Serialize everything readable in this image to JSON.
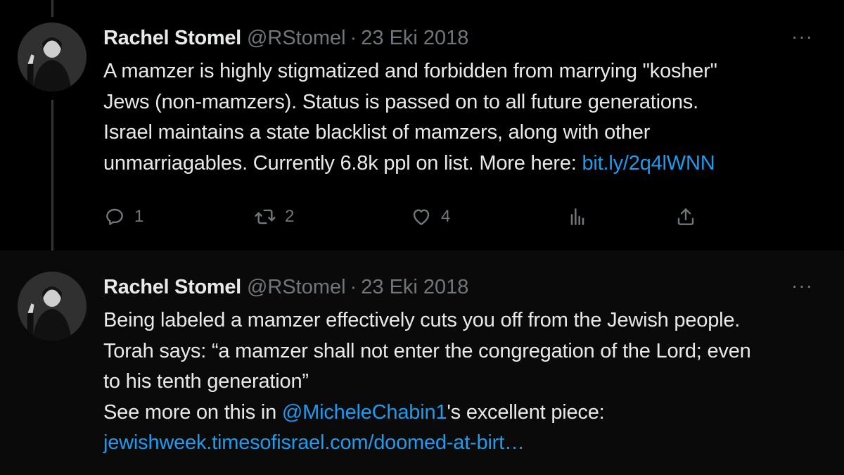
{
  "tweets": [
    {
      "author": {
        "name": "Rachel Stomel",
        "handle": "@RStomel",
        "separator": "·",
        "date": "23 Eki 2018",
        "avatar": "profile-photo"
      },
      "more_icon": "more-horizontal-icon",
      "more_label": "···",
      "lines": [
        {
          "text": "A mamzer is highly stigmatized and forbidden from marrying \"kosher\""
        },
        {
          "text": "Jews (non-mamzers). Status is passed on to all future generations."
        },
        {
          "text": "Israel maintains a state blacklist of mamzers, along with other"
        },
        {
          "text": "unmarriagables. Currently 6.8k ppl on list. More here: ",
          "link": "bit.ly/2q4lWNN"
        }
      ],
      "actions": {
        "reply": {
          "icon": "reply-icon",
          "count": "1"
        },
        "retweet": {
          "icon": "retweet-icon",
          "count": "2"
        },
        "like": {
          "icon": "heart-icon",
          "count": "4"
        },
        "views": {
          "icon": "analytics-icon"
        },
        "share": {
          "icon": "share-icon"
        }
      }
    },
    {
      "author": {
        "name": "Rachel Stomel",
        "handle": "@RStomel",
        "separator": "·",
        "date": "23 Eki 2018",
        "avatar": "profile-photo"
      },
      "more_icon": "more-horizontal-icon",
      "more_label": "···",
      "lines": [
        {
          "text": "Being labeled a mamzer effectively cuts you off from the Jewish people."
        },
        {
          "text": "Torah says: “a mamzer shall not enter the congregation of the Lord; even"
        },
        {
          "text": "to his tenth generation”"
        },
        {
          "pre": "See more on this in ",
          "mention": "@MicheleChabin1",
          "post": "'s excellent piece:"
        },
        {
          "link": "jewishweek.timesofisrael.com/doomed-at-birt…"
        }
      ]
    }
  ],
  "colors": {
    "background": "#000000",
    "text_primary": "#e7e9ea",
    "text_secondary": "#71767b",
    "link": "#1d9bf0",
    "thread_line": "#333639"
  }
}
